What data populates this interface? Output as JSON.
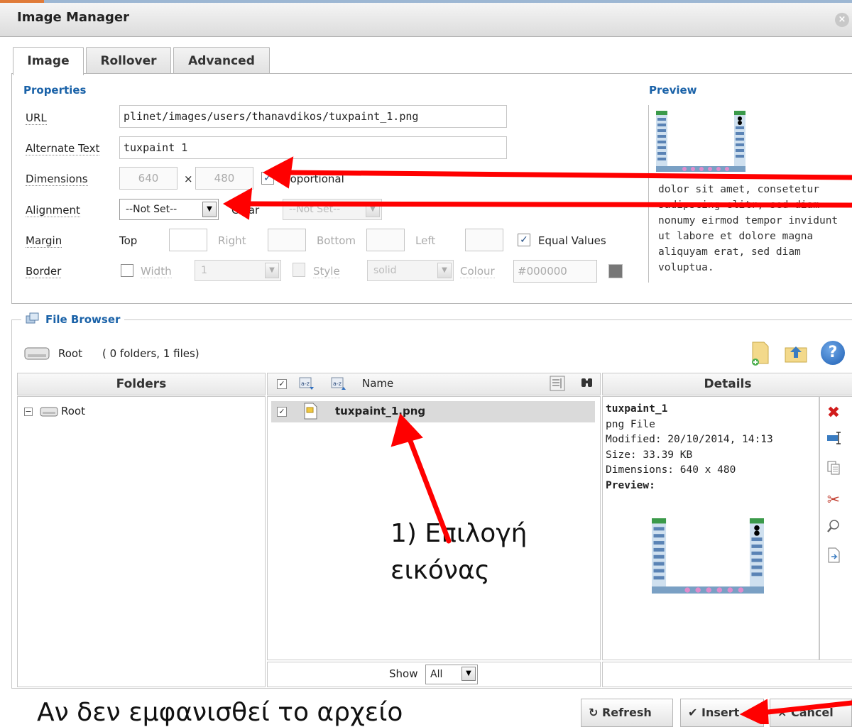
{
  "dialog": {
    "title": "Image Manager",
    "close_glyph": "×"
  },
  "tabs": [
    {
      "label": "Image",
      "active": true
    },
    {
      "label": "Rollover",
      "active": false
    },
    {
      "label": "Advanced",
      "active": false
    }
  ],
  "properties": {
    "heading": "Properties",
    "url_label": "URL",
    "url_value": "plinet/images/users/thanavdikos/tuxpaint_1.png",
    "alt_label": "Alternate Text",
    "alt_value": "tuxpaint 1",
    "dimensions_label": "Dimensions",
    "width_value": "640",
    "times": "×",
    "height_value": "480",
    "proportional_label": "Proportional",
    "alignment_label": "Alignment",
    "alignment_value": "--Not Set--",
    "clear_label": "Clear",
    "clear_value": "--Not Set--",
    "margin_label": "Margin",
    "margin_top": "Top",
    "margin_right": "Right",
    "margin_bottom": "Bottom",
    "margin_left": "Left",
    "equal_values_label": "Equal Values",
    "border_label": "Border",
    "border_width_label": "Width",
    "border_width_value": "1",
    "border_style_label": "Style",
    "border_style_value": "solid",
    "border_colour_label": "Colour",
    "border_colour_value": "#000000"
  },
  "preview": {
    "heading": "Preview",
    "text": "dolor sit amet, consetetur sadipscing elitr, sed diam nonumy eirmod tempor invidunt ut labore et dolore magna aliquyam erat, sed diam voluptua."
  },
  "file_browser": {
    "legend": "File Browser",
    "path_label": "Root",
    "path_info": "( 0 folders, 1 files)",
    "folders_header": "Folders",
    "name_header": "Name",
    "details_header": "Details",
    "folder_tree": [
      {
        "label": "Root"
      }
    ],
    "files": [
      {
        "name": "tuxpaint_1.png",
        "selected": true
      }
    ],
    "show_label": "Show",
    "show_value": "All"
  },
  "details": {
    "name": "tuxpaint_1",
    "type": "png File",
    "modified": "Modified: 20/10/2014, 14:13",
    "size": "Size: 33.39 KB",
    "dimensions": "Dimensions: 640 x 480",
    "preview_label": "Preview:"
  },
  "footer": {
    "refresh_label": "Refresh",
    "insert_label": "Insert",
    "cancel_label": "Cancel"
  },
  "annotations": {
    "step1_line1": "1) Επιλογή",
    "step1_line2": "εικόνας",
    "bottom_note": "Αν δεν εμφανισθεί το αρχείο"
  },
  "colors": {
    "accent": "#1a62a8",
    "arrow": "#ff0000",
    "delete_icon": "#d11b1b"
  },
  "icons": [
    "close-icon",
    "file-browser-icon",
    "drive-icon",
    "new-folder-icon",
    "upload-icon",
    "help-icon",
    "sort-az-icon",
    "list-view-icon",
    "search-icon",
    "png-file-icon",
    "delete-icon",
    "rename-icon",
    "copy-icon",
    "cut-icon",
    "zoom-icon",
    "insert-file-icon",
    "refresh-icon",
    "check-icon"
  ]
}
